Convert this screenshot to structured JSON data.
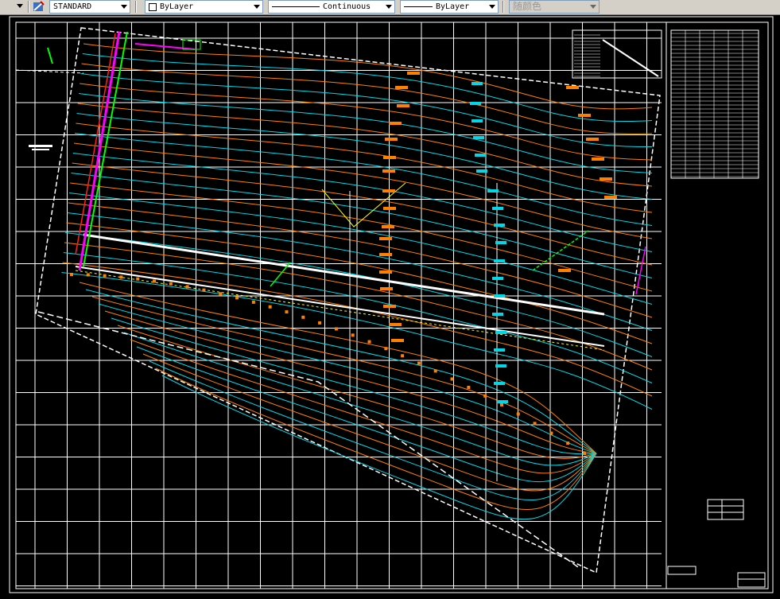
{
  "toolbar": {
    "dimstyle": "STANDARD",
    "layer_color": "ByLayer",
    "linetype": "Continuous",
    "lineweight": "ByLayer",
    "plotstyle": "随颜色"
  },
  "colors": {
    "background": "#000000",
    "grid": "#ffffff",
    "contour_a": "#ff8000",
    "contour_b": "#00d8e8",
    "magenta": "#ff00ff",
    "green": "#00ff00"
  },
  "icons": [
    "dropdown-arrow-icon",
    "dimstyle-icon",
    "color-swatch-icon"
  ]
}
